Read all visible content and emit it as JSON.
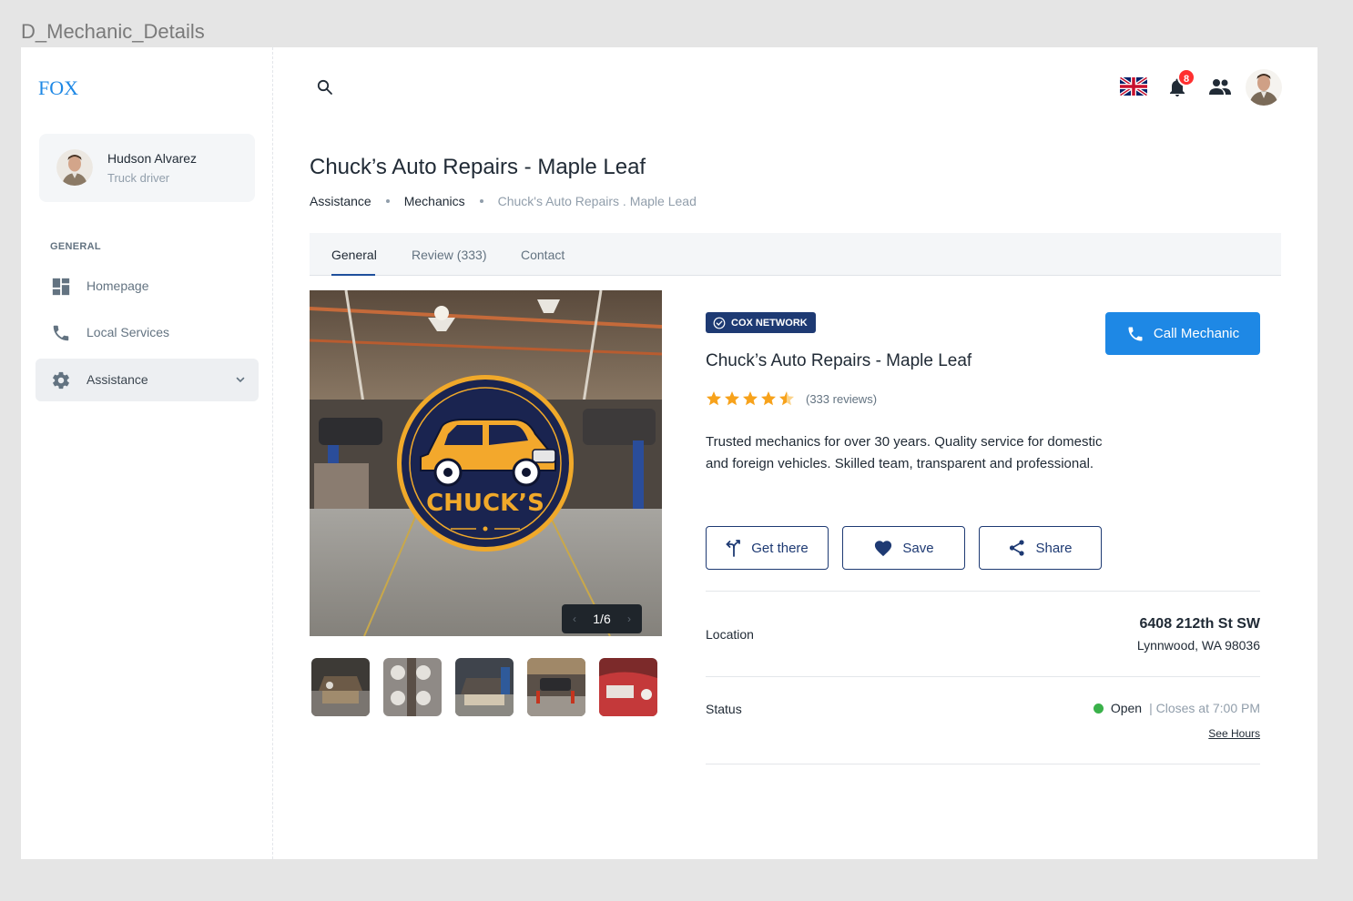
{
  "frame_label": "D_Mechanic_Details",
  "brand": "FOX",
  "user": {
    "name": "Hudson Alvarez",
    "role": "Truck driver"
  },
  "nav": {
    "section": "GENERAL",
    "items": [
      {
        "label": "Homepage",
        "icon": "dashboard-icon"
      },
      {
        "label": "Local Services",
        "icon": "phone-icon"
      },
      {
        "label": "Assistance",
        "icon": "gear-icon",
        "active": true
      }
    ]
  },
  "header": {
    "notifications_count": "8",
    "language": "English (UK)"
  },
  "page": {
    "title": "Chuck’s Auto Repairs - Maple Leaf",
    "breadcrumb": [
      "Assistance",
      "Mechanics",
      "Chuck's Auto Repairs . Maple Lead"
    ]
  },
  "tabs": [
    "General",
    "Review (333)",
    "Contact"
  ],
  "gallery": {
    "counter": "1/6",
    "logo_text": "CHUCK’S",
    "thumbnail_count": 5
  },
  "detail": {
    "network_badge": "COX NETWORK",
    "call_button": "Call Mechanic",
    "title": "Chuck’s Auto Repairs - Maple Leaf",
    "rating": 4.5,
    "reviews": "(333 reviews)",
    "description": "Trusted mechanics for over 30 years. Quality service for domestic and foreign vehicles. Skilled team, transparent and professional.",
    "actions": [
      "Get there",
      "Save",
      "Share"
    ],
    "location_label": "Location",
    "address_line1": "6408 212th St SW",
    "address_line2": "Lynnwood, WA 98036",
    "status_label": "Status",
    "status_open": "Open",
    "status_closes": "| Closes at 7:00 PM",
    "see_hours": "See Hours"
  },
  "colors": {
    "primary": "#1e88e5",
    "navy": "#1e3a73",
    "star": "#f7a21b",
    "open": "#3ab14a",
    "badge": "#ff3030"
  }
}
